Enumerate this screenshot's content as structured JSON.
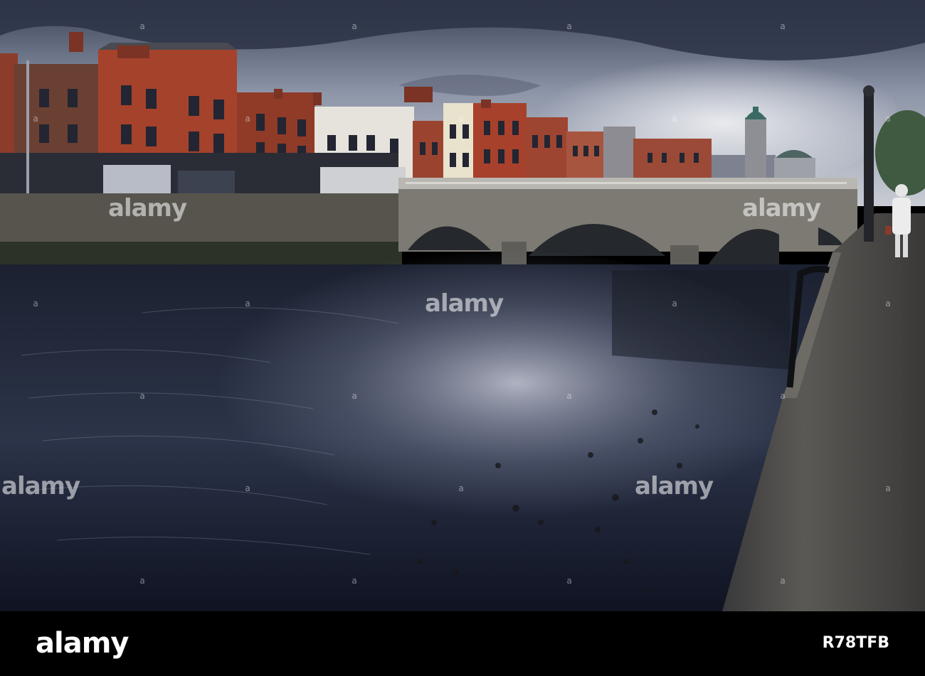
{
  "watermark": {
    "text": "alamy",
    "image_id": "R78TFB"
  },
  "footer": {
    "brand": "alamy",
    "image_id": "R78TFB"
  },
  "scene_colors": {
    "sky": "#8e96ab",
    "water": "#1d2335",
    "brick": "#a5422c",
    "stone": "#5c5a55"
  }
}
